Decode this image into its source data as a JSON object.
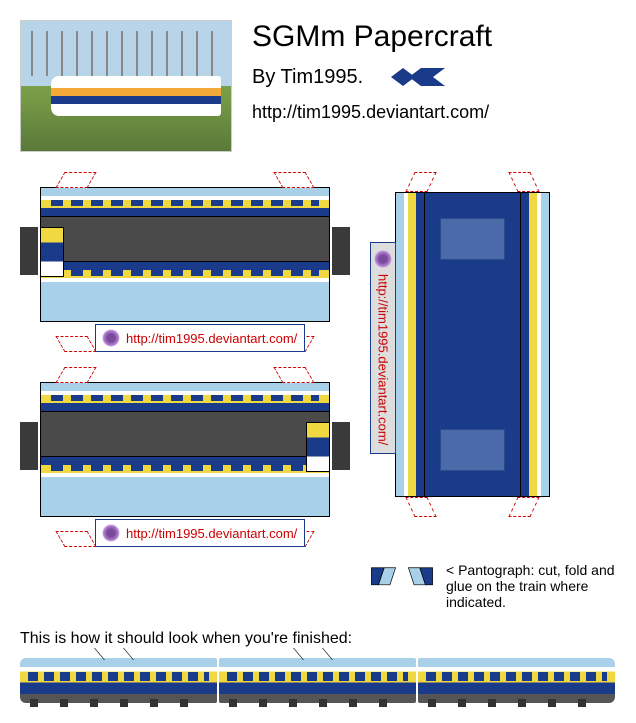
{
  "header": {
    "title": "SGMm Papercraft",
    "author": "By Tim1995.",
    "url": "http://tim1995.deviantart.com/"
  },
  "cutouts": {
    "watermark_url": "http://tim1995.deviantart.com/"
  },
  "pantograph": {
    "label": "< Pantograph: cut, fold and glue on the train where indicated."
  },
  "finished": {
    "text": "This is how it should look when you're finished:"
  }
}
